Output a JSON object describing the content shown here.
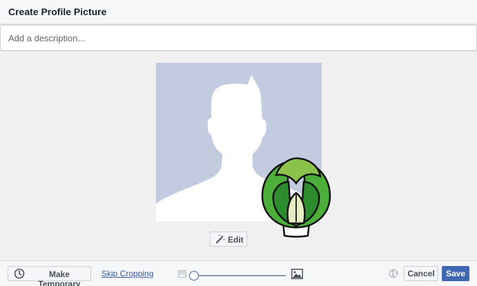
{
  "dialog": {
    "title": "Create Profile Picture"
  },
  "description": {
    "placeholder": "Add a description...",
    "value": ""
  },
  "photo": {
    "silhouette_bg": "#c3cbe1",
    "silhouette_fg": "#ffffff"
  },
  "edit": {
    "label": "Edit",
    "icon": "magic-wand-icon"
  },
  "footer": {
    "make_temporary_label": "Make Temporary",
    "make_temporary_icon": "clock-icon",
    "skip_cropping_label": "Skip Cropping",
    "zoom": {
      "level": 0,
      "min_icon": "small-image-icon",
      "max_icon": "large-image-icon"
    },
    "privacy_icon": "globe-icon",
    "cancel_label": "Cancel",
    "save_label": "Save"
  },
  "colors": {
    "primary": "#4267b2",
    "link": "#365899",
    "sprout_dark": "#2e8b2e",
    "sprout_mid": "#4caf3a",
    "sprout_light": "#8bc34a",
    "sprout_pale": "#e6efc4"
  }
}
